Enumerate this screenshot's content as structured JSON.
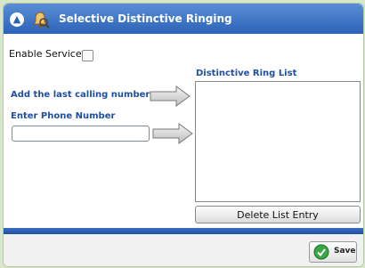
{
  "header": {
    "title": "Selective Distinctive Ringing"
  },
  "enable_service": {
    "label": "Enable Service:",
    "checked": false
  },
  "add_last": {
    "label": "Add the last calling number"
  },
  "phone": {
    "label": "Enter Phone Number",
    "value": ""
  },
  "ring_list": {
    "label": "Distinctive Ring List",
    "entries": []
  },
  "delete_button": {
    "label": "Delete List Entry"
  },
  "save_button": {
    "label": "Save"
  },
  "colors": {
    "accent": "#2c62b8",
    "label_blue": "#1f4fa0",
    "background": "#d8e6c9"
  },
  "icons": {
    "up": "up-arrow-icon",
    "bell": "bell-icon",
    "save": "checkmark-icon",
    "arrow": "right-arrow-icon"
  }
}
